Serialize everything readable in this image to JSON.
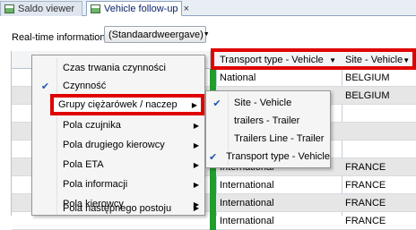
{
  "tabs": [
    {
      "label": "Saldo viewer",
      "close": ""
    },
    {
      "label": "Vehicle follow-up",
      "close": "×"
    }
  ],
  "toolbar": {
    "realtime_label": "Real-time information",
    "view_button": "(Standaardweergave)"
  },
  "grid": {
    "columns": [
      {
        "label": "Transport type - Vehicle"
      },
      {
        "label": "Site - Vehicle"
      }
    ],
    "rows": [
      {
        "c1": "National",
        "c2": "BELGIUM"
      },
      {
        "c1": "National",
        "c2": "BELGIUM"
      },
      {
        "c1": "",
        "c2": ""
      },
      {
        "c1": "",
        "c2": ""
      },
      {
        "c1": "",
        "c2": ""
      },
      {
        "c1": "International",
        "c2": "FRANCE"
      },
      {
        "c1": "International",
        "c2": "FRANCE"
      },
      {
        "c1": "International",
        "c2": "FRANCE"
      },
      {
        "c1": "International",
        "c2": "FRANCE"
      }
    ]
  },
  "context_menu": {
    "items": [
      {
        "label": "Czas trwania czynności",
        "checked": "",
        "arrow": ""
      },
      {
        "label": "Czynność",
        "checked": "✔",
        "arrow": ""
      },
      {
        "label": "Grupy ciężarówek / naczep",
        "checked": "",
        "arrow": "▶"
      },
      {
        "label": "Pola czujnika",
        "checked": "",
        "arrow": "▶"
      },
      {
        "label": "Pola drugiego kierowcy",
        "checked": "",
        "arrow": "▶"
      },
      {
        "label": "Pola ETA",
        "checked": "",
        "arrow": "▶"
      },
      {
        "label": "Pola informacji",
        "checked": "",
        "arrow": "▶"
      },
      {
        "label": "Pola kierowcy",
        "checked": "",
        "arrow": "▶"
      },
      {
        "label": "Pola następnego postoju",
        "checked": "",
        "arrow": "▶"
      }
    ]
  },
  "submenu": {
    "items": [
      {
        "label": "Site - Vehicle",
        "checked": "✔"
      },
      {
        "label": "trailers - Trailer",
        "checked": ""
      },
      {
        "label": "Trailers Line - Trailer",
        "checked": ""
      },
      {
        "label": "Transport type - Vehicle",
        "checked": "✔"
      }
    ]
  },
  "colors": {
    "highlight": "#e00000",
    "status_green": "#1f9e2c",
    "check_blue": "#1b57b1"
  }
}
